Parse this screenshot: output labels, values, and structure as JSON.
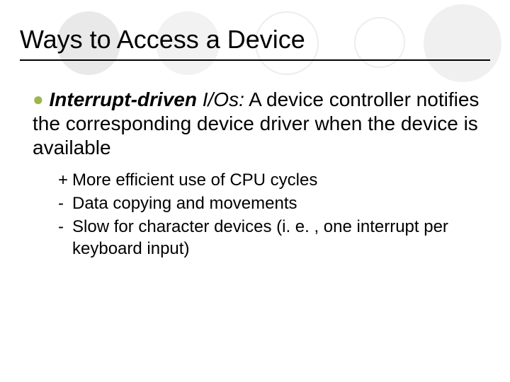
{
  "slide": {
    "title": "Ways to Access a Device",
    "main": {
      "bullet_glyph": "●",
      "term_strong": "Interrupt-driven",
      "term_tail": " I/Os:",
      "body_rest": "  A device controller notifies the corresponding device driver when the device is available"
    },
    "sub": [
      {
        "mark": "+",
        "text": "More efficient use of CPU cycles"
      },
      {
        "mark": "-",
        "text": "Data copying and movements"
      },
      {
        "mark": "-",
        "text": "Slow for character devices (i. e. , one interrupt per keyboard input)"
      }
    ]
  }
}
